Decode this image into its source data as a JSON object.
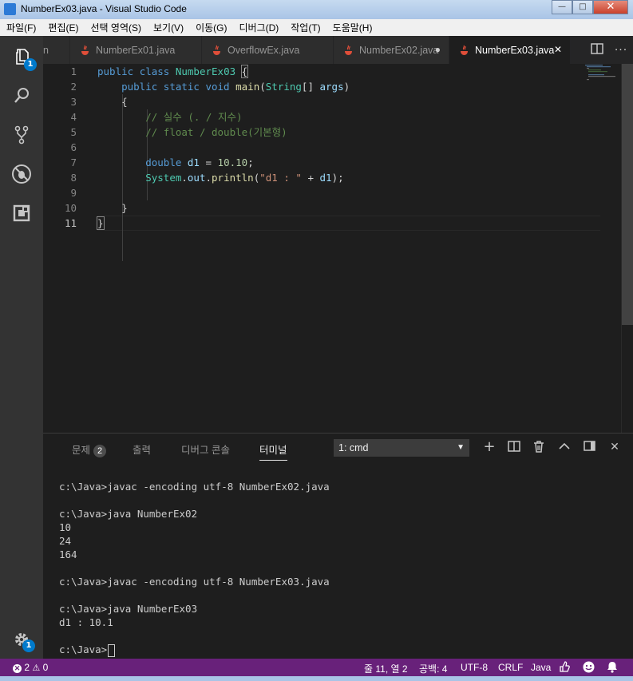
{
  "window": {
    "title": "NumberEx03.java - Visual Studio Code",
    "minimize": "—",
    "maximize": "□",
    "close": "✕"
  },
  "menu": [
    "파일(F)",
    "편집(E)",
    "선택 영역(S)",
    "보기(V)",
    "이동(G)",
    "디버그(D)",
    "작업(T)",
    "도움말(H)"
  ],
  "activity": {
    "explorer_badge": "1",
    "settings_badge": "1"
  },
  "tabs": [
    {
      "label": "n",
      "marker": ""
    },
    {
      "label": "NumberEx01.java",
      "marker": ""
    },
    {
      "label": "OverflowEx.java",
      "marker": ""
    },
    {
      "label": "NumberEx02.java",
      "marker": "●"
    },
    {
      "label": "NumberEx03.java",
      "marker": "✕"
    }
  ],
  "editor": {
    "line_numbers": [
      "1",
      "2",
      "3",
      "4",
      "5",
      "6",
      "7",
      "8",
      "9",
      "10",
      "11"
    ]
  },
  "panel": {
    "tabs": [
      "문제",
      "출력",
      "디버그 콘솔",
      "터미널"
    ],
    "problems_count": "2",
    "terminal_select": "1: cmd",
    "terminal_lines": [
      "c:\\Java>javac -encoding utf-8 NumberEx02.java",
      "",
      "c:\\Java>java NumberEx02",
      "10",
      "24",
      "164",
      "",
      "c:\\Java>javac -encoding utf-8 NumberEx03.java",
      "",
      "c:\\Java>java NumberEx03",
      "d1 : 10.1",
      "",
      "c:\\Java>"
    ]
  },
  "statusbar": {
    "errors": "2",
    "warnings": "0",
    "position": "줄 11, 열 2",
    "spaces": "공백: 4",
    "encoding": "UTF-8",
    "eol": "CRLF",
    "language": "Java"
  }
}
